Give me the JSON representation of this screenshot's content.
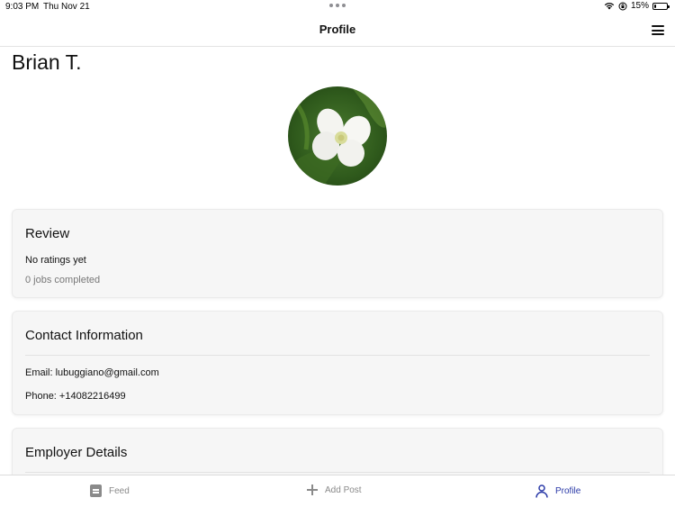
{
  "status_bar": {
    "time": "9:03 PM",
    "date": "Thu Nov 21",
    "battery": "15%",
    "battery_level": 0.15
  },
  "nav": {
    "title": "Profile",
    "menu_icon": "hamburger-menu-icon"
  },
  "profile": {
    "name": "Brian T.",
    "avatar": "flower-photo"
  },
  "review": {
    "title": "Review",
    "ratings": "No ratings yet",
    "jobs": "0 jobs completed"
  },
  "contact": {
    "title": "Contact Information",
    "email": "Email: lubuggiano@gmail.com",
    "phone": "Phone: +14082216499"
  },
  "employer": {
    "title": "Employer Details"
  },
  "tabs": [
    {
      "label": "Feed",
      "icon": "feed-icon",
      "active": false
    },
    {
      "label": "Add Post",
      "icon": "plus-icon",
      "active": false
    },
    {
      "label": "Profile",
      "icon": "person-icon",
      "active": true
    }
  ],
  "colors": {
    "accent": "#2b3aa8",
    "inactive": "#8a8a8a"
  }
}
